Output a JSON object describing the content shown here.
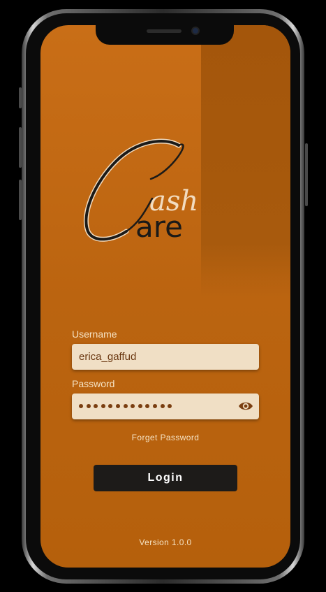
{
  "brand": {
    "logo_script": "ash",
    "logo_word": "are",
    "logo_initial": "C"
  },
  "form": {
    "username_label": "Username",
    "username_value": "erica_gaffud",
    "password_label": "Password",
    "password_masked_length": 13,
    "forgot_label": "Forget Password",
    "login_label": "Login"
  },
  "footer": {
    "version": "Version 1.0.0"
  },
  "icons": {
    "password_toggle": "eye-icon"
  },
  "colors": {
    "background": "#bb6410",
    "field": "#f0dfc5",
    "button": "#1d1b19",
    "text_light": "#f6e3c4"
  }
}
